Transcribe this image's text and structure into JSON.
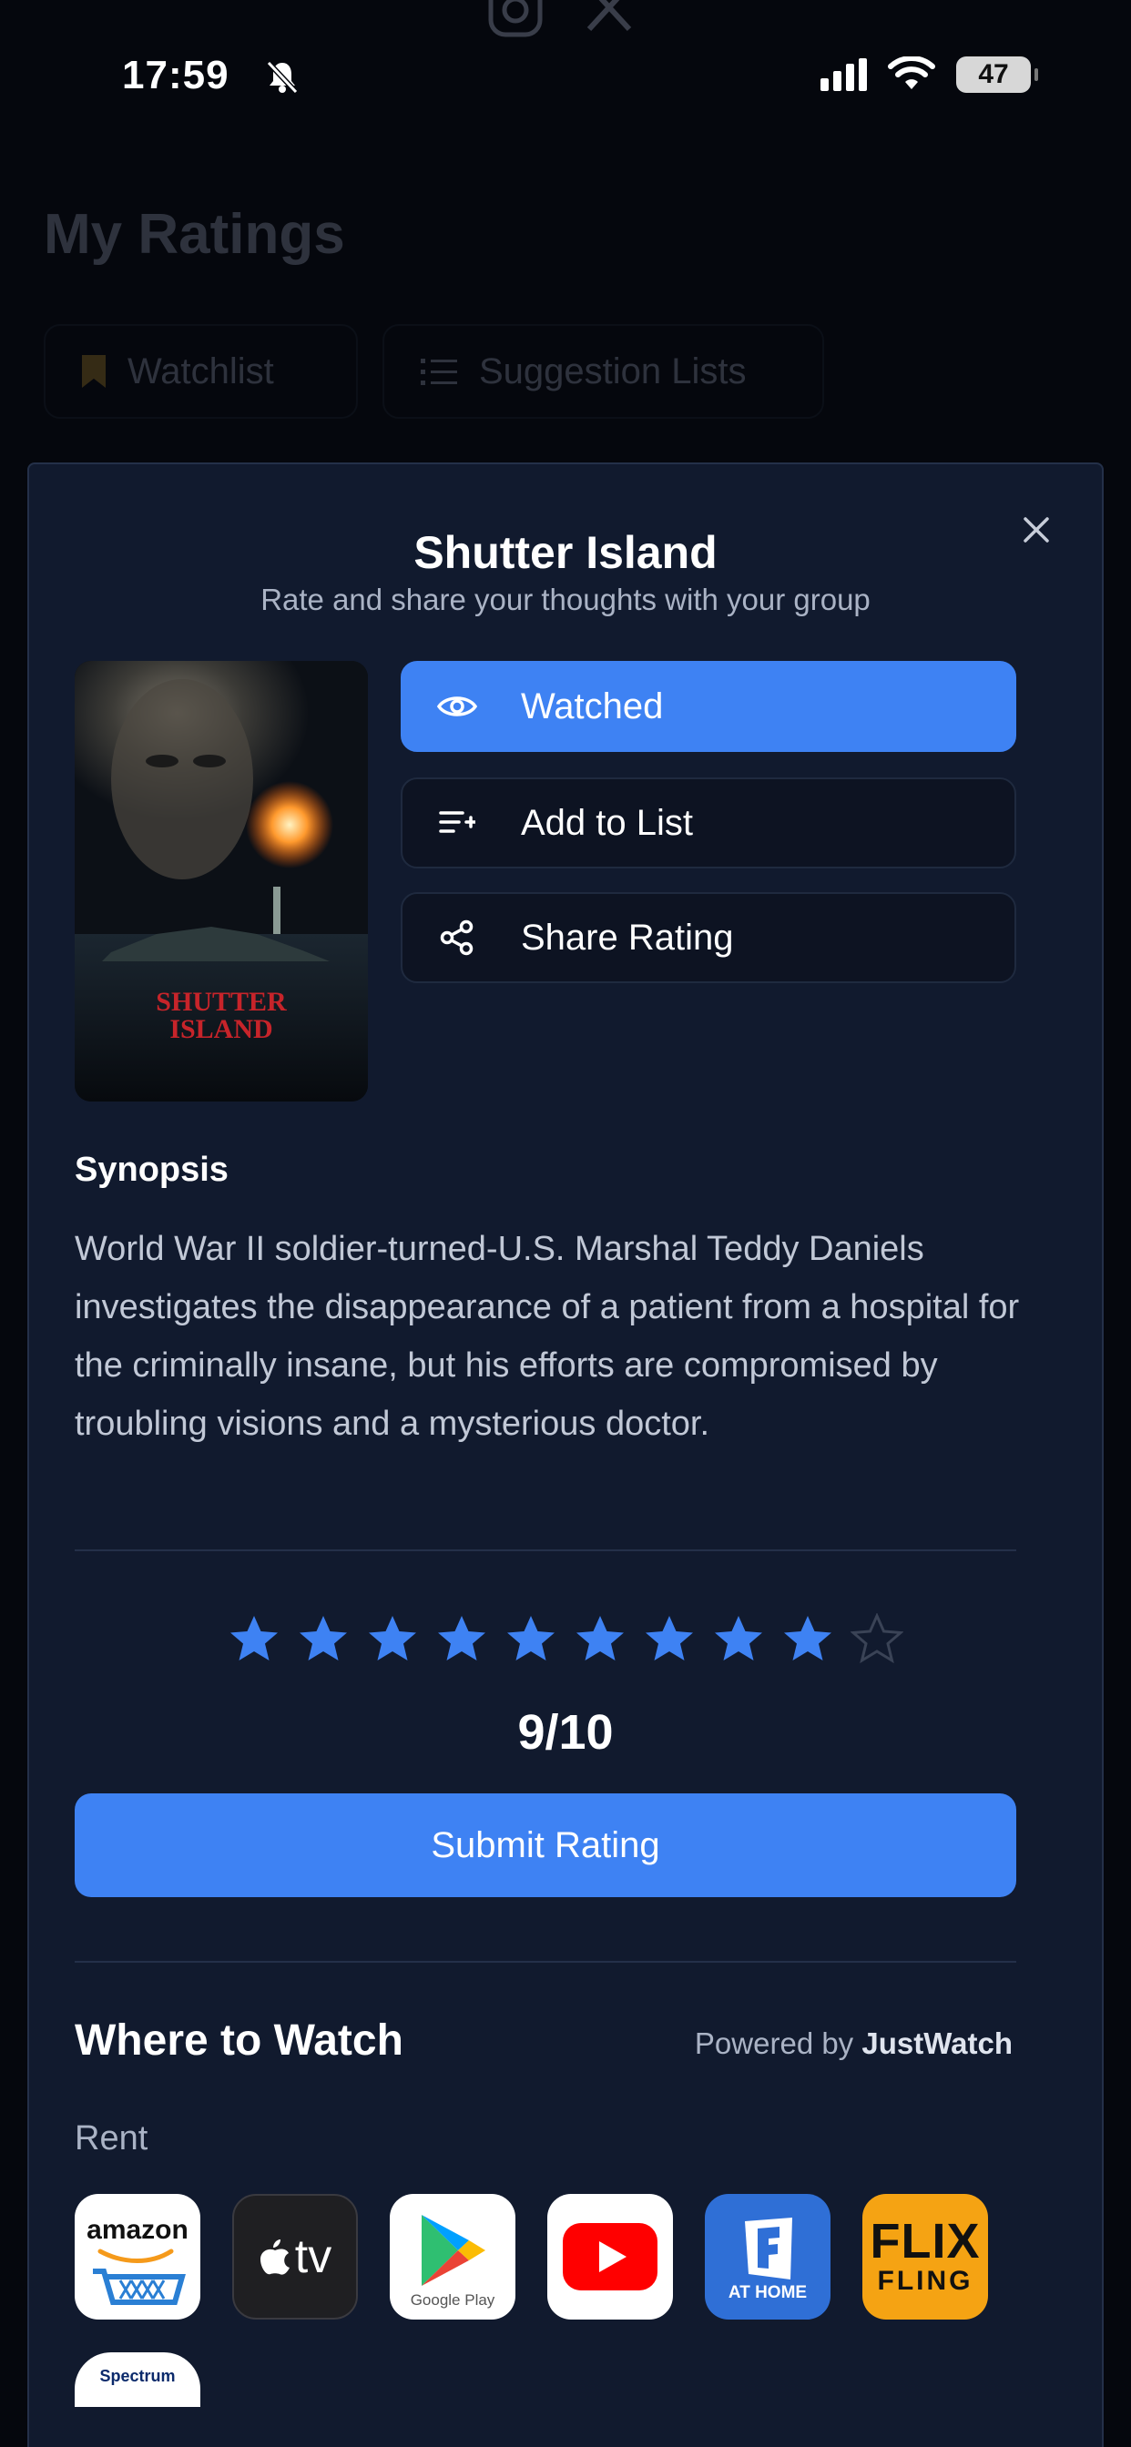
{
  "status_bar": {
    "time": "17:59",
    "battery": "47"
  },
  "background": {
    "title": "My Ratings",
    "tabs": [
      {
        "label": "Watchlist"
      },
      {
        "label": "Suggestion Lists"
      }
    ]
  },
  "modal": {
    "title": "Shutter Island",
    "subtitle": "Rate and share your thoughts with your group",
    "poster_text": "SHUTTER ISLAND",
    "actions": [
      {
        "label": "Watched",
        "icon": "eye-icon",
        "active": true
      },
      {
        "label": "Add to List",
        "icon": "add-list-icon",
        "active": false
      },
      {
        "label": "Share Rating",
        "icon": "share-icon",
        "active": false
      }
    ],
    "synopsis_heading": "Synopsis",
    "synopsis": "World War II soldier-turned-U.S. Marshal Teddy Daniels investigates the disappearance of a patient from a hospital for the criminally insane, but his efforts are compromised by troubling visions and a mysterious doctor.",
    "rating": {
      "value": 9,
      "max": 10,
      "display": "9/10"
    },
    "submit_label": "Submit Rating",
    "where_to_watch": {
      "title": "Where to Watch",
      "powered_by_prefix": "Powered by",
      "powered_by_brand": "JustWatch",
      "rent_label": "Rent",
      "providers": [
        {
          "name": "amazon",
          "icon": "amazon-icon",
          "text": "amazon"
        },
        {
          "name": "Apple TV",
          "icon": "apple-tv-icon",
          "text": "tv"
        },
        {
          "name": "Google Play",
          "icon": "google-play-icon",
          "text": "Google Play"
        },
        {
          "name": "YouTube",
          "icon": "youtube-icon"
        },
        {
          "name": "Fandango at Home",
          "icon": "fandango-icon",
          "text": "AT HOME"
        },
        {
          "name": "FlixFling",
          "icon": "flixfling-icon",
          "text_top": "FLIX",
          "text_bottom": "FLING"
        },
        {
          "name": "Spectrum",
          "icon": "spectrum-icon",
          "text": "Spectrum"
        }
      ]
    }
  },
  "colors": {
    "accent": "#3e82f3",
    "modal_bg": "#111a2e",
    "star_filled": "#3e82f3",
    "star_empty": "#3a4356"
  }
}
